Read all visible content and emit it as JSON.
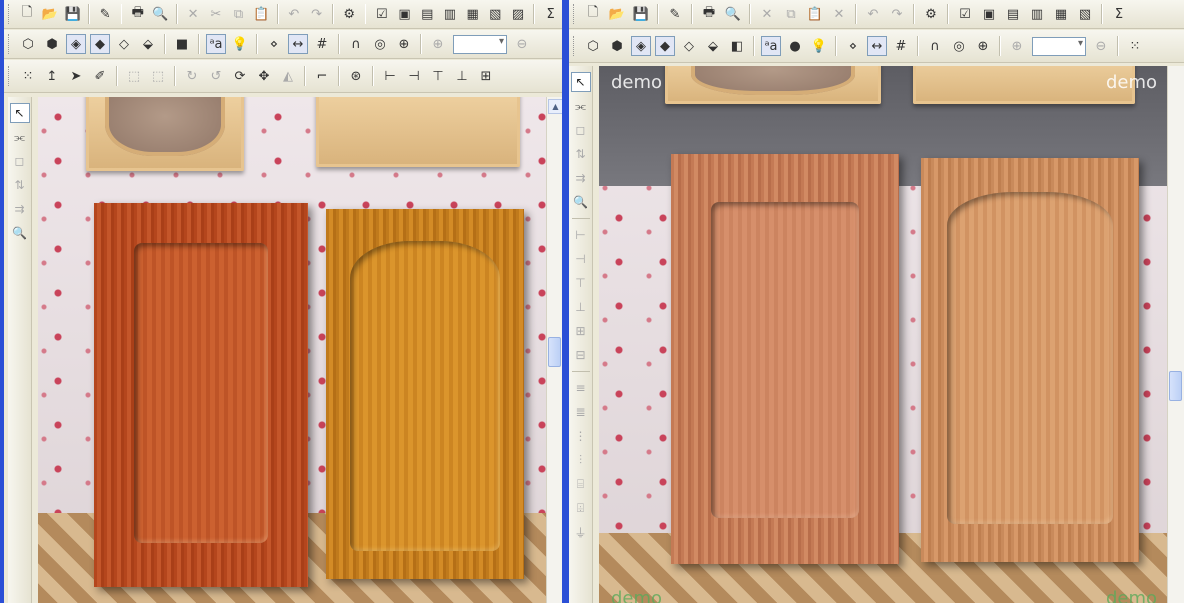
{
  "left": {
    "toolbar1": [
      "new-file",
      "open-folder",
      "save",
      "edit-props",
      "print",
      "print-preview",
      "cut",
      "copy-scissors",
      "copy",
      "paste",
      "undo",
      "redo",
      "settings",
      "checklist",
      "window-a",
      "window-b",
      "window-c",
      "window-d",
      "window-e",
      "window-f",
      "sigma"
    ],
    "toolbar2": [
      "cube-1",
      "cube-2",
      "cube-3",
      "cube-4",
      "cube-5",
      "cube-6",
      "cube-solid",
      "text-aa",
      "bulb",
      "snap",
      "measure",
      "grid",
      "magnet",
      "target",
      "target-2",
      "zoom-in",
      "zoom-combo",
      "zoom-out"
    ],
    "toolbar3": [
      "select-all",
      "move-up",
      "arrow-select",
      "pencil",
      "frame-1",
      "frame-2",
      "rotate-1",
      "rotate-2",
      "rotate-3",
      "move",
      "mirror",
      "corner",
      "target-3",
      "align-1",
      "align-2",
      "align-3",
      "align-4",
      "align-5"
    ],
    "vertical_tools": [
      "pointer",
      "wire",
      "shape",
      "align-v",
      "distribute",
      "zoom"
    ],
    "viewport_label": ""
  },
  "right": {
    "toolbar1": [
      "new-file",
      "open-folder",
      "save",
      "edit-props",
      "print",
      "print-preview",
      "cut",
      "copy",
      "paste",
      "delete",
      "undo",
      "redo",
      "settings",
      "checklist",
      "window-a",
      "window-b",
      "window-c",
      "window-d",
      "window-e",
      "sigma"
    ],
    "toolbar2": [
      "cube-1",
      "cube-2",
      "cube-3",
      "cube-4",
      "cube-5",
      "cube-6",
      "cube-7",
      "text-aa",
      "sphere",
      "bulb",
      "snap",
      "measure",
      "grid",
      "magnet",
      "target",
      "target-2",
      "zoom-in",
      "zoom-combo",
      "zoom-out",
      "grid-dots"
    ],
    "vertical_tools": [
      "pointer",
      "wire",
      "shape",
      "align-v",
      "distribute",
      "zoom",
      "sep",
      "tool-a",
      "tool-b",
      "tool-c",
      "tool-d",
      "tool-e",
      "tool-f",
      "sep2",
      "tool-g",
      "tool-h",
      "tool-i",
      "tool-j",
      "tool-k",
      "tool-l",
      "tool-m"
    ],
    "watermark_top_left": "demo",
    "watermark_top_right": "demo",
    "watermark_bottom_left": "demo",
    "watermark_bottom_right": "demo"
  },
  "icons": {
    "new-file": "🗋",
    "open-folder": "📂",
    "save": "💾",
    "edit-props": "✎",
    "print": "🖶",
    "print-preview": "🔍",
    "cut": "✕",
    "copy-scissors": "✂",
    "copy": "⧉",
    "paste": "📋",
    "delete": "✕",
    "undo": "↶",
    "redo": "↷",
    "settings": "⚙",
    "checklist": "☑",
    "window-a": "▣",
    "window-b": "▤",
    "window-c": "▥",
    "window-d": "▦",
    "window-e": "▧",
    "window-f": "▨",
    "sigma": "Σ",
    "cube-1": "⬡",
    "cube-2": "⬢",
    "cube-3": "◈",
    "cube-4": "◆",
    "cube-5": "◇",
    "cube-6": "⬙",
    "cube-7": "◧",
    "cube-solid": "■",
    "text-aa": "ᵃa",
    "bulb": "💡",
    "sphere": "●",
    "snap": "⋄",
    "measure": "↔",
    "grid": "#",
    "magnet": "∩",
    "target": "◎",
    "target-2": "⊕",
    "zoom-in": "⊕",
    "zoom-out": "⊖",
    "zoom-combo": "",
    "grid-dots": "⁙",
    "select-all": "⁙",
    "move-up": "↥",
    "arrow-select": "➤",
    "pencil": "✐",
    "frame-1": "⬚",
    "frame-2": "⬚",
    "rotate-1": "↻",
    "rotate-2": "↺",
    "rotate-3": "⟳",
    "move": "✥",
    "mirror": "◭",
    "corner": "⌐",
    "target-3": "⊛",
    "align-1": "⊢",
    "align-2": "⊣",
    "align-3": "⊤",
    "align-4": "⊥",
    "align-5": "⊞",
    "pointer": "↖",
    "wire": "⫘",
    "shape": "◻",
    "align-v": "⇅",
    "distribute": "⇉",
    "zoom": "🔍",
    "sep": "",
    "sep2": "",
    "tool-a": "⊢",
    "tool-b": "⊣",
    "tool-c": "⊤",
    "tool-d": "⊥",
    "tool-e": "⊞",
    "tool-f": "⊟",
    "tool-g": "≡",
    "tool-h": "≣",
    "tool-i": "⋮",
    "tool-j": "⫶",
    "tool-k": "⌸",
    "tool-l": "⌹",
    "tool-m": "⏚"
  },
  "disabled": [
    "cut",
    "copy-scissors",
    "copy",
    "paste",
    "delete",
    "redo",
    "frame-1",
    "frame-2",
    "rotate-1",
    "rotate-2",
    "mirror",
    "zoom-in",
    "zoom-out",
    "shape",
    "align-v",
    "distribute",
    "tool-a",
    "tool-b",
    "tool-c",
    "tool-d",
    "tool-e",
    "tool-f",
    "tool-g",
    "tool-h",
    "tool-i",
    "tool-j",
    "tool-k",
    "tool-l",
    "tool-m",
    "undo"
  ],
  "pressed": [
    "cube-4",
    "text-aa",
    "measure",
    "cube-3"
  ]
}
